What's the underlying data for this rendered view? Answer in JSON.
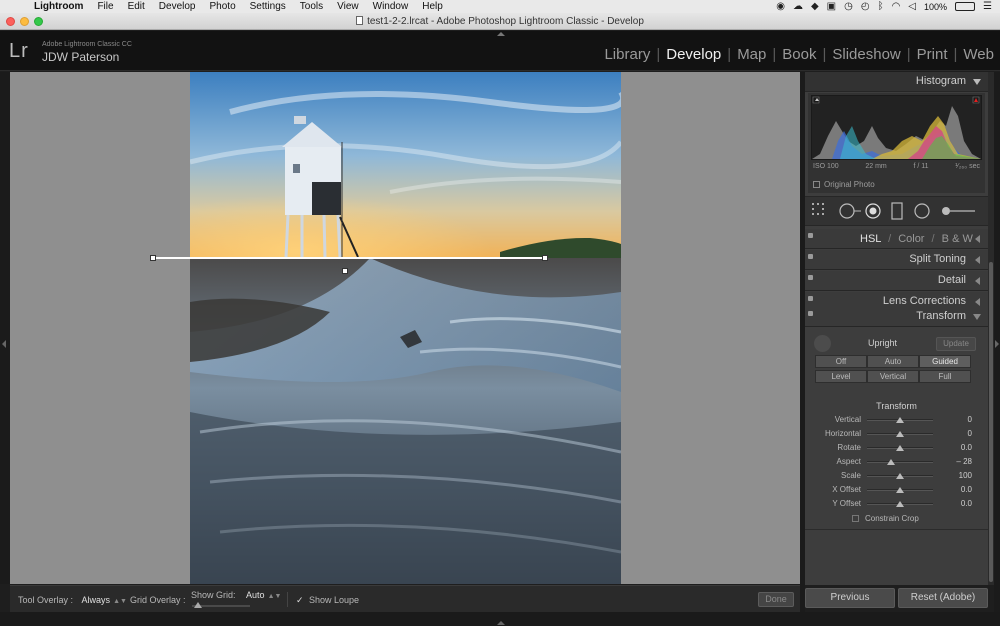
{
  "menubar": {
    "app_name": "Lightroom",
    "items": [
      "File",
      "Edit",
      "Develop",
      "Photo",
      "Settings",
      "Tools",
      "View",
      "Window",
      "Help"
    ],
    "battery": "100%"
  },
  "window": {
    "title": "test1-2-2.lrcat - Adobe Photoshop Lightroom Classic - Develop"
  },
  "identity": {
    "logo": "Lr",
    "product": "Adobe Lightroom Classic CC",
    "user": "JDW Paterson"
  },
  "modules": {
    "items": [
      "Library",
      "Develop",
      "Map",
      "Book",
      "Slideshow",
      "Print",
      "Web"
    ],
    "active": "Develop",
    "separator": "|"
  },
  "toolbar": {
    "tool_overlay_label": "Tool Overlay :",
    "tool_overlay_value": "Always",
    "grid_overlay_label": "Grid Overlay :",
    "show_grid_label": "Show Grid:",
    "show_grid_value": "Auto",
    "show_loupe_label": "Show Loupe",
    "show_loupe_checked": "✓",
    "done_label": "Done"
  },
  "panels": {
    "histogram": {
      "title": "Histogram",
      "iso": "ISO 100",
      "focal": "22 mm",
      "aperture": "f / 11",
      "shutter": "¹⁄₂₆₀ sec",
      "original_photo": "Original Photo"
    },
    "hsl": {
      "hsl": "HSL",
      "color": "Color",
      "bw": "B & W",
      "slash": "/"
    },
    "split_toning": {
      "title": "Split Toning"
    },
    "detail": {
      "title": "Detail"
    },
    "lens_corrections": {
      "title": "Lens Corrections"
    },
    "transform": {
      "title": "Transform",
      "upright_label": "Upright",
      "update_label": "Update",
      "upright_row1": [
        "Off",
        "Auto",
        "Guided"
      ],
      "upright_row2": [
        "Level",
        "Vertical",
        "Full"
      ],
      "subtitle": "Transform",
      "sliders": [
        {
          "label": "Vertical",
          "value": "0",
          "pos": 0.5
        },
        {
          "label": "Horizontal",
          "value": "0",
          "pos": 0.5
        },
        {
          "label": "Rotate",
          "value": "0.0",
          "pos": 0.5
        },
        {
          "label": "Aspect",
          "value": "– 28",
          "pos": 0.36
        },
        {
          "label": "Scale",
          "value": "100",
          "pos": 0.5
        },
        {
          "label": "X Offset",
          "value": "0.0",
          "pos": 0.5
        },
        {
          "label": "Y Offset",
          "value": "0.0",
          "pos": 0.5
        }
      ],
      "constrain_crop": "Constrain Crop"
    }
  },
  "bottom_buttons": {
    "previous": "Previous",
    "reset": "Reset (Adobe)"
  }
}
